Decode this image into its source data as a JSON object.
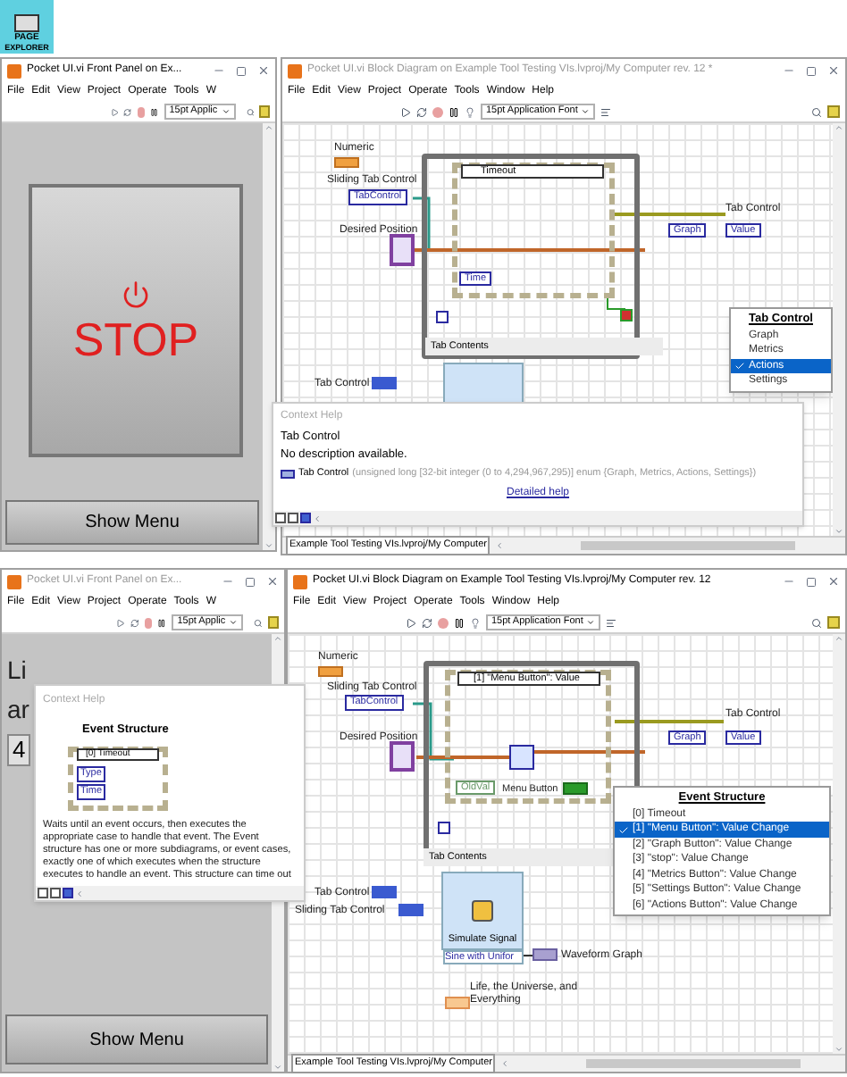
{
  "logo": {
    "line1": "PAGE",
    "line2": "EXPLORER"
  },
  "top": {
    "front_panel": {
      "title": "Pocket UI.vi Front Panel on Ex...",
      "active": true,
      "menu": [
        "File",
        "Edit",
        "View",
        "Project",
        "Operate",
        "Tools",
        "W"
      ],
      "font_field": "15pt Applic",
      "stop_button": "STOP",
      "show_menu_button": "Show Menu"
    },
    "block_diagram": {
      "title": "Pocket UI.vi Block Diagram on Example Tool Testing VIs.lvproj/My Computer rev. 12 *",
      "active": false,
      "menu": [
        "File",
        "Edit",
        "View",
        "Project",
        "Operate",
        "Tools",
        "Window",
        "Help"
      ],
      "font_field": "15pt Application Font",
      "diagram": {
        "numeric": "Numeric",
        "sliding_tab_control": "Sliding Tab Control",
        "tab_control_ref": "TabControl",
        "desired_position": "Desired Position",
        "event_case": "Timeout",
        "time_node": "Time",
        "tab_control": "Tab Control",
        "graph_enum": "Graph",
        "value_node": "Value",
        "tab_contents": "Tab Contents",
        "tab_control_terminal": "Tab Control"
      },
      "popup": {
        "title": "Tab Control",
        "items": [
          {
            "label": "Graph",
            "selected": false
          },
          {
            "label": "Metrics",
            "selected": false
          },
          {
            "label": "Actions",
            "selected": true
          },
          {
            "label": "Settings",
            "selected": false
          }
        ]
      },
      "status": "Example Tool Testing VIs.lvproj/My Computer"
    },
    "context_help": {
      "title": "Context Help",
      "heading": "Tab Control",
      "description": "No description available.",
      "terminal_name": "Tab Control",
      "terminal_type": "(unsigned long [32-bit integer (0 to 4,294,967,295)] enum {Graph, Metrics, Actions, Settings})",
      "link": "Detailed help"
    }
  },
  "bottom": {
    "front_panel": {
      "title": "Pocket UI.vi Front Panel on Ex...",
      "active": false,
      "menu": [
        "File",
        "Edit",
        "View",
        "Project",
        "Operate",
        "Tools",
        "W"
      ],
      "font_field": "15pt Applic",
      "large_text": [
        "Li",
        "ar"
      ],
      "numeric_value": "4",
      "show_menu_button": "Show Menu"
    },
    "block_diagram": {
      "title": "Pocket UI.vi Block Diagram on Example Tool Testing VIs.lvproj/My Computer rev. 12",
      "active": true,
      "menu": [
        "File",
        "Edit",
        "View",
        "Project",
        "Operate",
        "Tools",
        "Window",
        "Help"
      ],
      "font_field": "15pt Application Font",
      "diagram": {
        "numeric": "Numeric",
        "sliding_tab_control": "Sliding Tab Control",
        "tab_control_ref": "TabControl",
        "desired_position": "Desired Position",
        "event_case": "[1] \"Menu Button\": Value",
        "old_value": "OldVal",
        "menu_button": "Menu Button",
        "tab_control": "Tab Control",
        "graph_enum": "Graph",
        "value_node": "Value",
        "tab_contents": "Tab Contents",
        "tab_control_terminal": "Tab Control",
        "sliding_tab_terminal": "Sliding Tab Control",
        "simulate_signal": "Simulate Signal",
        "signal_type": "Sine with Unifor",
        "waveform_graph": "Waveform Graph",
        "life_label": "Life, the Universe, and Everything"
      },
      "popup": {
        "title": "Event Structure",
        "items": [
          {
            "label": "[0]  Timeout",
            "selected": false
          },
          {
            "label": "[1]  \"Menu Button\": Value Change",
            "selected": true
          },
          {
            "label": "[2]  \"Graph Button\": Value Change",
            "selected": false
          },
          {
            "label": "[3]  \"stop\": Value Change",
            "selected": false
          },
          {
            "label": "[4]  \"Metrics Button\": Value Change",
            "selected": false
          },
          {
            "label": "[5]  \"Settings Button\": Value Change",
            "selected": false
          },
          {
            "label": "[6]  \"Actions Button\": Value Change",
            "selected": false
          }
        ]
      },
      "status": "Example Tool Testing VIs.lvproj/My Computer"
    },
    "context_help": {
      "title": "Context Help",
      "heading": "Event Structure",
      "case_label": "[0] Timeout",
      "type_label": "Type",
      "time_label": "Time",
      "description": "Waits until an event occurs, then executes the appropriate case to handle that event. The Event structure has one or more subdiagrams, or event cases, exactly one of which executes when the structure executes to handle an event. This structure can time out"
    }
  }
}
